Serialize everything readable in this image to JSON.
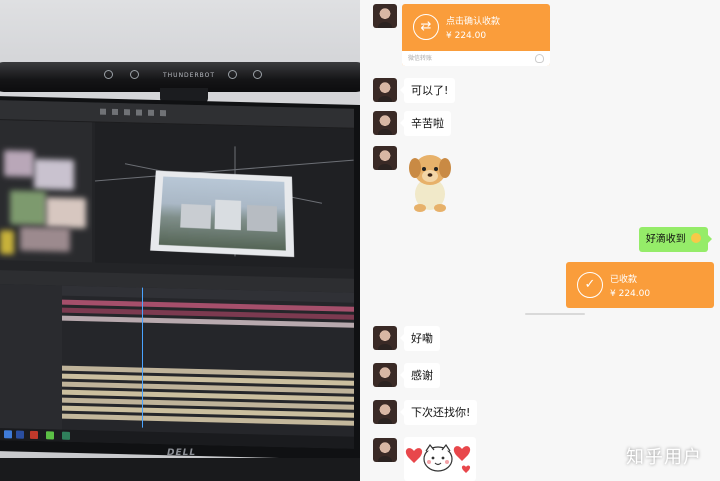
{
  "left_photo": {
    "lamp_brand": "THUNDERBOT",
    "monitor_logo": "DELL"
  },
  "chat": {
    "transfer_pending": {
      "title": "点击确认收款",
      "amount": "¥ 224.00",
      "footer": "微信转账"
    },
    "messages_a": [
      {
        "text": "可以了!"
      },
      {
        "text": "辛苦啦"
      }
    ],
    "sticker_1": "puppy-sticker",
    "reply_out": "好滴收到",
    "transfer_received": {
      "title": "已收款",
      "amount": "¥ 224.00"
    },
    "messages_b": [
      {
        "text": "好嘞"
      },
      {
        "text": "感谢"
      },
      {
        "text": "下次还找你!"
      }
    ],
    "sticker_2": "heart-sticker"
  },
  "watermark": "知乎用户",
  "colors": {
    "transfer_orange": "#fa9d3b",
    "outgoing_green": "#95ec69",
    "chat_bg": "#f7f7f7"
  }
}
